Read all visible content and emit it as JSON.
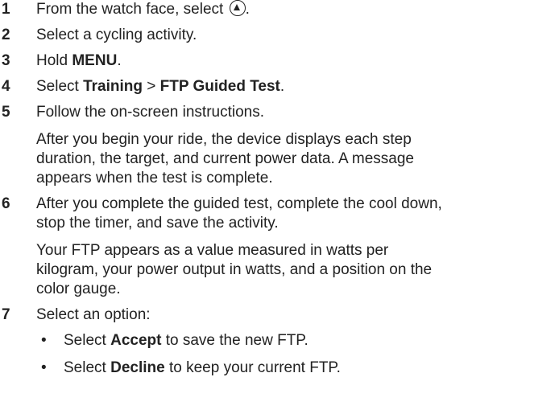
{
  "steps": [
    {
      "num": "1",
      "a": "From the watch face, select ",
      "icon": "up-button-icon",
      "b": "."
    },
    {
      "num": "2",
      "text": "Select a cycling activity."
    },
    {
      "num": "3",
      "a": "Hold ",
      "bold": "MENU",
      "b": "."
    },
    {
      "num": "4",
      "a": "Select ",
      "bold1": "Training",
      "sep": " > ",
      "bold2": "FTP Guided Test",
      "b": "."
    },
    {
      "num": "5",
      "text": "Follow the on-screen instructions.",
      "note": [
        "After you begin your ride, the device displays each step",
        "duration, the target, and current power data. A message",
        "appears when the test is complete."
      ]
    },
    {
      "num": "6",
      "lines": [
        "After you complete the guided test, complete the cool down,",
        "stop the timer, and save the activity."
      ],
      "note": [
        "Your FTP appears as a value measured in watts per",
        "kilogram, your power output in watts, and a position on the",
        "color gauge."
      ]
    },
    {
      "num": "7",
      "text": "Select an option:",
      "bullets": [
        {
          "dot": "•",
          "a": "Select ",
          "bold": "Accept",
          "b": " to save the new FTP."
        },
        {
          "dot": "•",
          "a": "Select ",
          "bold": "Decline",
          "b": " to keep your current FTP."
        }
      ]
    }
  ]
}
